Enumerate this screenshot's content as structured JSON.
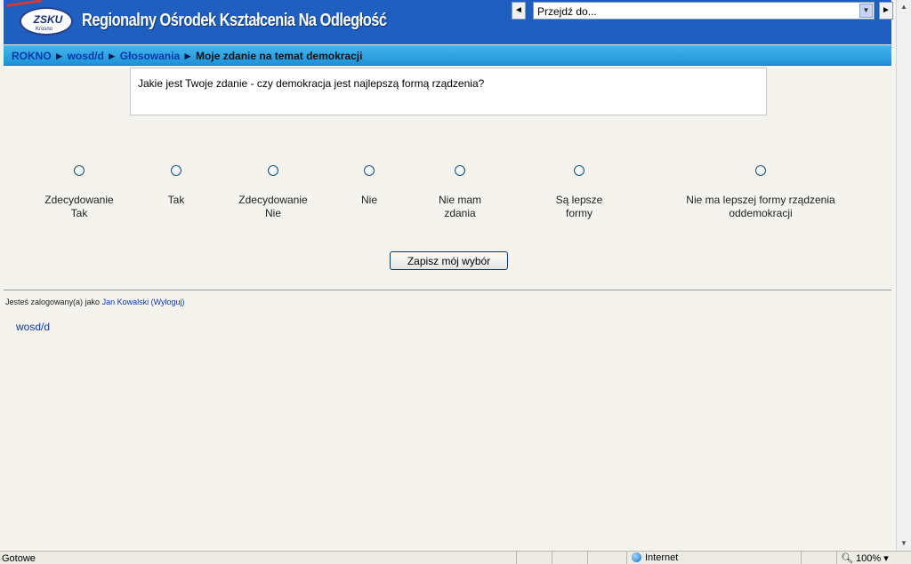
{
  "header": {
    "logo_text": "ZSKU",
    "logo_subtext": "Krosno",
    "site_title": "Regionalny Ośrodek Kształcenia Na Odległość",
    "jump_prev": "◄",
    "jump_next": "►",
    "jump_value": "Przejdź do..."
  },
  "breadcrumb": {
    "items": [
      "ROKNO",
      "wosd/d",
      "Głosowania"
    ],
    "separator": "►",
    "current": "Moje zdanie na temat demokracji"
  },
  "question": "Jakie jest Twoje zdanie - czy demokracja jest najlepszą formą rządzenia?",
  "options": [
    {
      "line1": "Zdecydowanie",
      "line2": "Tak"
    },
    {
      "line1": "Tak",
      "line2": ""
    },
    {
      "line1": "Zdecydowanie",
      "line2": "Nie"
    },
    {
      "line1": "Nie",
      "line2": ""
    },
    {
      "line1": "Nie mam",
      "line2": "zdania"
    },
    {
      "line1": "Są lepsze",
      "line2": "formy"
    },
    {
      "line1": "Nie ma lepszej formy rządzenia",
      "line2": "oddemokracji"
    }
  ],
  "submit_label": "Zapisz mój wybór",
  "footer": {
    "logged_prefix": "Jesteś zalogowany(a) jako ",
    "user_name": "Jan Kowalski",
    "logout": "(Wyloguj)",
    "course_link": "wosd/d"
  },
  "statusbar": {
    "status": "Gotowe",
    "zone": "Internet",
    "zoom": "100%"
  },
  "colors": {
    "header_bg": "#1f5fbf",
    "nav_bg": "#2ea6e6",
    "link": "#0a3aa8"
  }
}
